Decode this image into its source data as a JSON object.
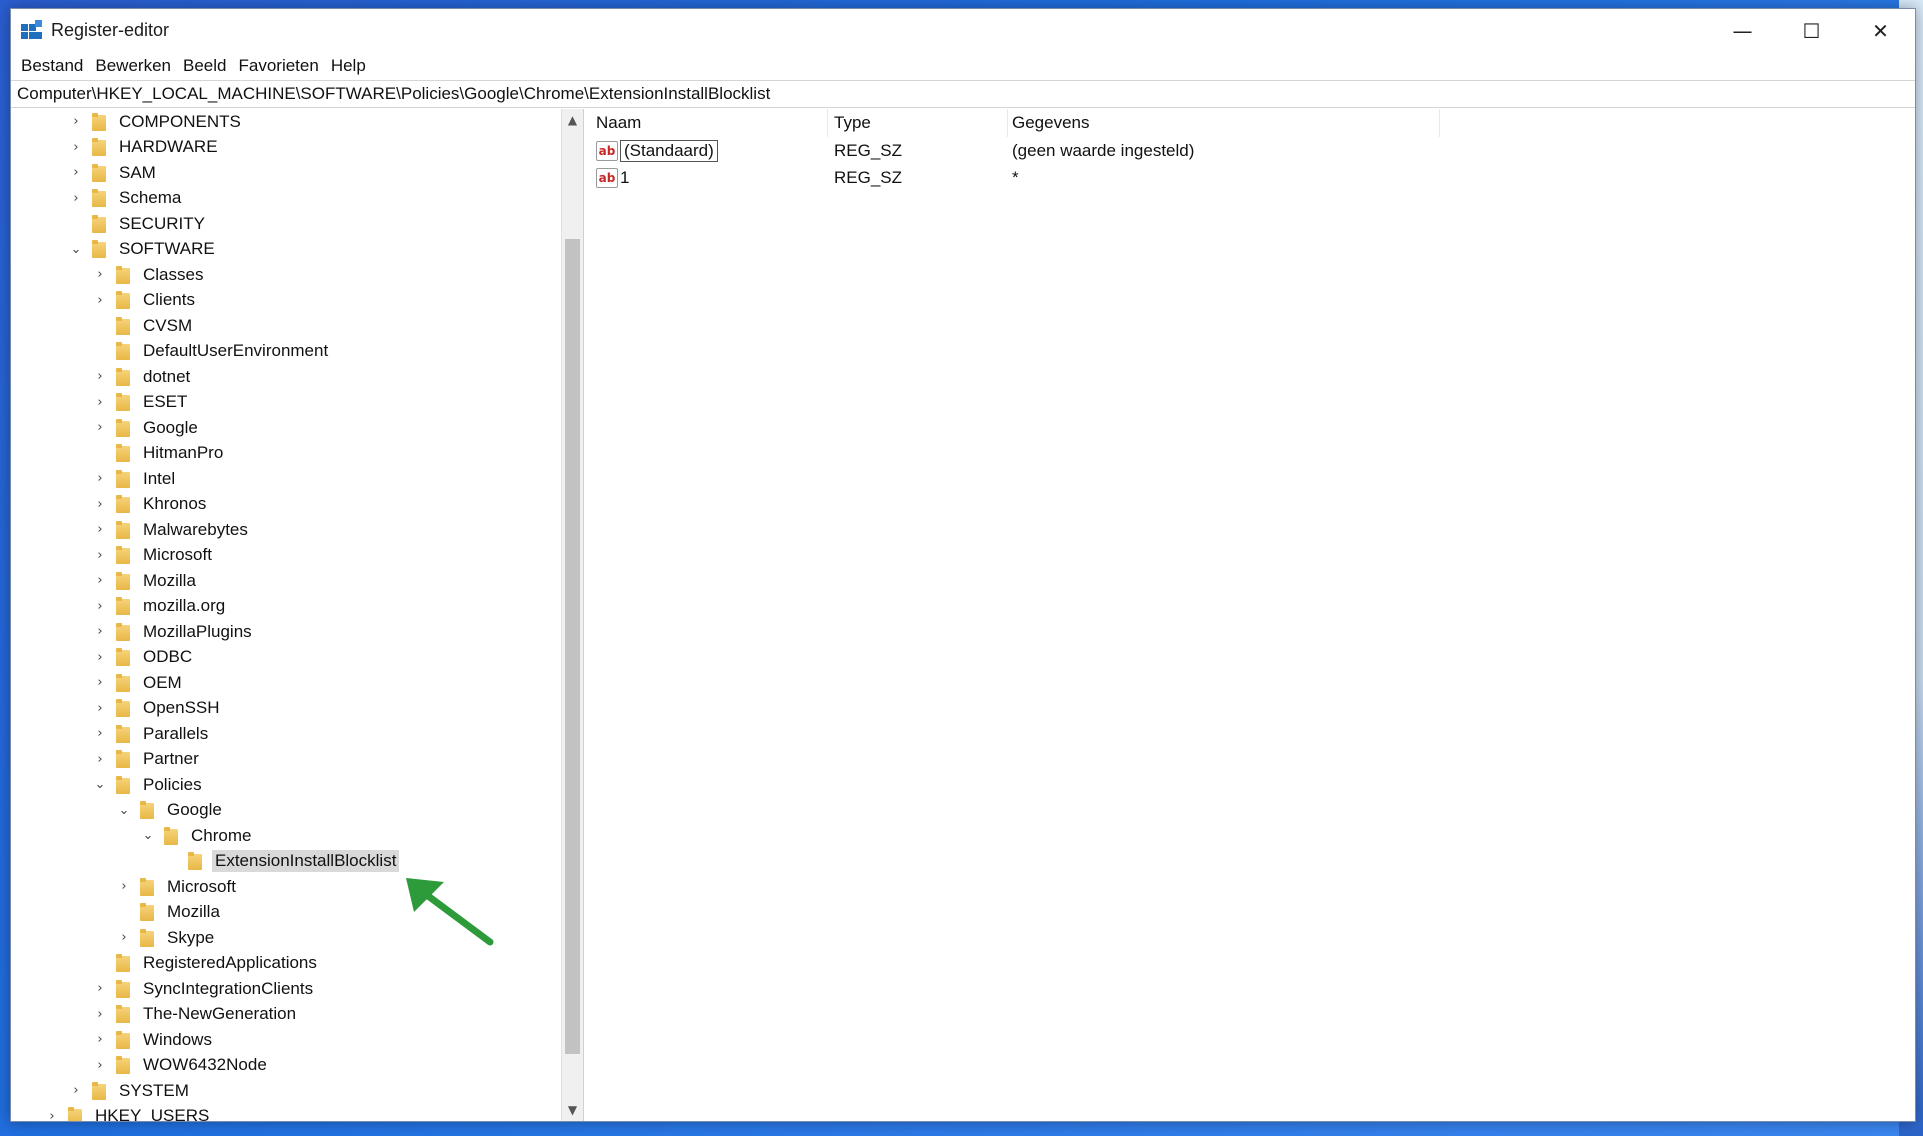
{
  "window": {
    "title": "Register-editor",
    "controls": {
      "minimize": "—",
      "maximize": "☐",
      "close": "✕"
    }
  },
  "menu": [
    "Bestand",
    "Bewerken",
    "Beeld",
    "Favorieten",
    "Help"
  ],
  "address": "Computer\\HKEY_LOCAL_MACHINE\\SOFTWARE\\Policies\\Google\\Chrome\\ExtensionInstallBlocklist",
  "tree": [
    {
      "label": "COMPONENTS",
      "level": 0,
      "state": "collapsed"
    },
    {
      "label": "HARDWARE",
      "level": 0,
      "state": "collapsed"
    },
    {
      "label": "SAM",
      "level": 0,
      "state": "collapsed"
    },
    {
      "label": "Schema",
      "level": 0,
      "state": "collapsed"
    },
    {
      "label": "SECURITY",
      "level": 0,
      "state": "leaf"
    },
    {
      "label": "SOFTWARE",
      "level": 0,
      "state": "expanded"
    },
    {
      "label": "Classes",
      "level": 1,
      "state": "collapsed"
    },
    {
      "label": "Clients",
      "level": 1,
      "state": "collapsed"
    },
    {
      "label": "CVSM",
      "level": 1,
      "state": "leaf"
    },
    {
      "label": "DefaultUserEnvironment",
      "level": 1,
      "state": "leaf"
    },
    {
      "label": "dotnet",
      "level": 1,
      "state": "collapsed"
    },
    {
      "label": "ESET",
      "level": 1,
      "state": "collapsed"
    },
    {
      "label": "Google",
      "level": 1,
      "state": "collapsed"
    },
    {
      "label": "HitmanPro",
      "level": 1,
      "state": "leaf"
    },
    {
      "label": "Intel",
      "level": 1,
      "state": "collapsed"
    },
    {
      "label": "Khronos",
      "level": 1,
      "state": "collapsed"
    },
    {
      "label": "Malwarebytes",
      "level": 1,
      "state": "collapsed"
    },
    {
      "label": "Microsoft",
      "level": 1,
      "state": "collapsed"
    },
    {
      "label": "Mozilla",
      "level": 1,
      "state": "collapsed"
    },
    {
      "label": "mozilla.org",
      "level": 1,
      "state": "collapsed"
    },
    {
      "label": "MozillaPlugins",
      "level": 1,
      "state": "collapsed"
    },
    {
      "label": "ODBC",
      "level": 1,
      "state": "collapsed"
    },
    {
      "label": "OEM",
      "level": 1,
      "state": "collapsed"
    },
    {
      "label": "OpenSSH",
      "level": 1,
      "state": "collapsed"
    },
    {
      "label": "Parallels",
      "level": 1,
      "state": "collapsed"
    },
    {
      "label": "Partner",
      "level": 1,
      "state": "collapsed"
    },
    {
      "label": "Policies",
      "level": 1,
      "state": "expanded"
    },
    {
      "label": "Google",
      "level": 2,
      "state": "expanded"
    },
    {
      "label": "Chrome",
      "level": 3,
      "state": "expanded"
    },
    {
      "label": "ExtensionInstallBlocklist",
      "level": 4,
      "state": "leaf",
      "selected": true
    },
    {
      "label": "Microsoft",
      "level": 2,
      "state": "collapsed"
    },
    {
      "label": "Mozilla",
      "level": 2,
      "state": "leaf"
    },
    {
      "label": "Skype",
      "level": 2,
      "state": "collapsed"
    },
    {
      "label": "RegisteredApplications",
      "level": 1,
      "state": "leaf"
    },
    {
      "label": "SyncIntegrationClients",
      "level": 1,
      "state": "collapsed"
    },
    {
      "label": "The-NewGeneration",
      "level": 1,
      "state": "collapsed"
    },
    {
      "label": "Windows",
      "level": 1,
      "state": "collapsed"
    },
    {
      "label": "WOW6432Node",
      "level": 1,
      "state": "collapsed"
    },
    {
      "label": "SYSTEM",
      "level": 0,
      "state": "collapsed"
    },
    {
      "label": "HKEY_USERS",
      "level": -1,
      "state": "collapsed"
    }
  ],
  "list": {
    "headers": {
      "name": "Naam",
      "type": "Type",
      "data": "Gegevens"
    },
    "rows": [
      {
        "name": "(Standaard)",
        "type": "REG_SZ",
        "data": "(geen waarde ingesteld)",
        "focused": true
      },
      {
        "name": "1",
        "type": "REG_SZ",
        "data": "*"
      }
    ]
  },
  "colors": {
    "annotation_arrow": "#2e9b3a",
    "selection": "#d9d9d9"
  }
}
